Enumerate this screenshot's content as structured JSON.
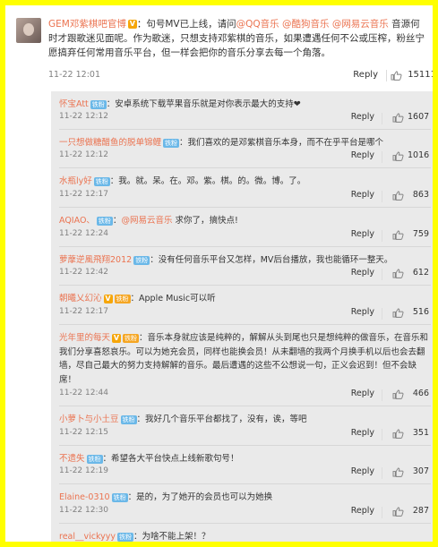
{
  "top_comment": {
    "username": "GEM邓紫棋吧官博",
    "text_before": "：句号MV已上线，请问",
    "mention1": "@QQ音乐",
    "mention2": "@酷狗音乐",
    "mention3": "@网易云音乐",
    "text_after": " 音源何时才跟歌迷见面呢。作为歌迷，只想支持邓紫棋的音乐，如果遭遇任何不公或压榨，粉丝宁愿搞弃任何常用音乐平台，但一样会把你的音乐分享去每一个角落。",
    "date": "11-22 12:01",
    "reply_label": "Reply",
    "likes": "15111"
  },
  "replies": [
    {
      "username": "怀宝Att",
      "badge": "铁粉",
      "text": "：安卓系统下载苹果音乐就是对你表示最大的支持❤",
      "date": "11-22 12:12",
      "reply_label": "Reply",
      "likes": "1607"
    },
    {
      "username": "一只想做糖醋鱼的脱单锦鲤",
      "badge": "铁粉",
      "text": "：我们喜欢的是邓紫棋音乐本身，而不在乎平台是哪个",
      "date": "11-22 12:12",
      "reply_label": "Reply",
      "likes": "1016"
    },
    {
      "username": "水瓶ly好",
      "badge": "铁粉",
      "text": "：我。就。呆。在。邓。紫。棋。的。微。博。了。",
      "date": "11-22 12:17",
      "reply_label": "Reply",
      "likes": "863"
    },
    {
      "username": "AQIAO、",
      "badge": "铁粉",
      "text_before": "：",
      "mention": "@网易云音乐",
      "text_after": " 求你了，搞快点!",
      "date": "11-22 12:24",
      "reply_label": "Reply",
      "likes": "759"
    },
    {
      "username": "萝藦逆風飛翔2012",
      "badge": "铁粉",
      "text": "：没有任何音乐平台又怎样，MV后台播放，我也能循环一整天。",
      "date": "11-22 12:42",
      "reply_label": "Reply",
      "likes": "612"
    },
    {
      "username": "朝曦乂幻沁",
      "badge": "铁粉",
      "text": "：Apple Music可以听",
      "date": "11-22 12:17",
      "reply_label": "Reply",
      "likes": "516"
    },
    {
      "username": "光年里的每天",
      "badge": "铁粉",
      "text": "：音乐本身就应该是纯粹的，解解从头到尾也只是想纯粹的做音乐，在音乐和我们分享喜怒哀乐。可以为她充会员，同样也能换会员！从未翻墙的我两个月换手机以后也会去翻墙，尽自己最大的努力支持解解的音乐。最后遭遇的这些不公想说一句，正义会迟到！但不会缺席！",
      "date": "11-22 12:44",
      "reply_label": "Reply",
      "likes": "466"
    },
    {
      "username": "小萝卜与小土豆",
      "badge": "铁粉",
      "text": "：我好几个音乐平台都找了，没有，诶，等吧",
      "date": "11-22 12:15",
      "reply_label": "Reply",
      "likes": "351"
    },
    {
      "username": "不遗失",
      "badge": "铁粉",
      "text": "：希望各大平台快点上线新歌句号！",
      "date": "11-22 12:19",
      "reply_label": "Reply",
      "likes": "307"
    },
    {
      "username": "Elaine-0310",
      "badge": "铁粉",
      "text": "：是的，为了她开的会员也可以为她换",
      "date": "11-22 12:30",
      "reply_label": "Reply",
      "likes": "287"
    },
    {
      "username": "real__vickyyy",
      "badge": "铁粉",
      "text": "：为啥不能上架！？"
    }
  ],
  "colors": {
    "accent": "#eb7350",
    "border": "#ffff00",
    "badge": "#6bb8e8"
  },
  "icons": {
    "like": "thumb-up-icon",
    "verified": "verified-v-icon"
  }
}
